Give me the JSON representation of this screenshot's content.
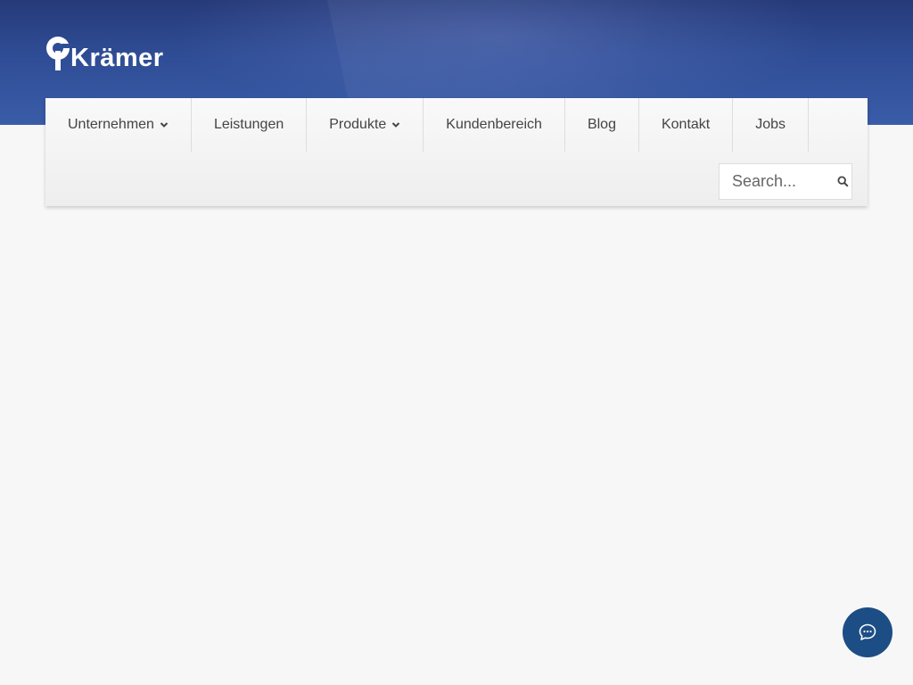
{
  "brand": {
    "logo_text": "Krämer",
    "accent": "#2f4d96"
  },
  "nav": {
    "items": [
      {
        "label": "Unternehmen",
        "has_dropdown": true
      },
      {
        "label": "Leistungen",
        "has_dropdown": false
      },
      {
        "label": "Produkte",
        "has_dropdown": true
      },
      {
        "label": "Kundenbereich",
        "has_dropdown": false
      },
      {
        "label": "Blog",
        "has_dropdown": false
      },
      {
        "label": "Kontakt",
        "has_dropdown": false
      },
      {
        "label": "Jobs",
        "has_dropdown": false
      }
    ]
  },
  "search": {
    "placeholder": "Search...",
    "value": "",
    "icon": "search-icon"
  },
  "chat": {
    "icon": "chat-bubble-icon",
    "color": "#1c4e85"
  }
}
